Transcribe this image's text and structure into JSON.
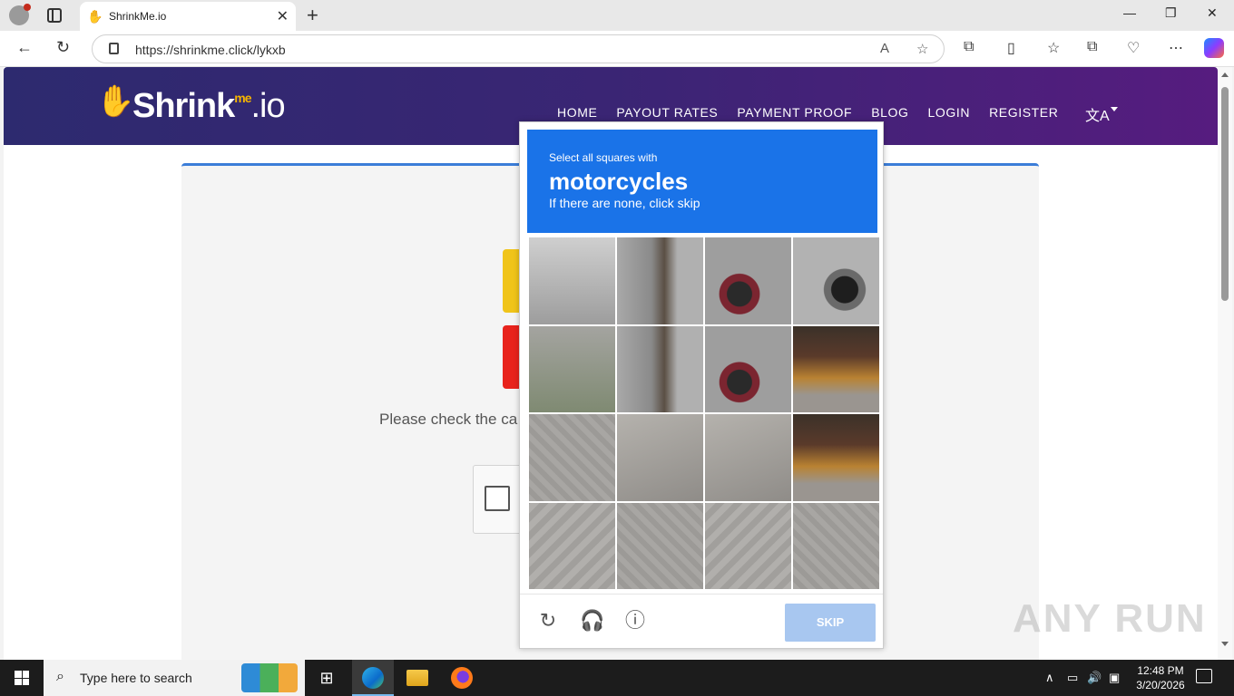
{
  "browser": {
    "tab_title": "ShrinkMe.io",
    "url": "https://shrinkme.click/lykxb",
    "new_tab_glyph": "+",
    "close_glyph": "✕"
  },
  "site": {
    "logo_main": "Shrink",
    "logo_me": "me",
    "logo_io": ".io",
    "nav": [
      "HOME",
      "PAYOUT RATES",
      "PAYMENT PROOF",
      "BLOG",
      "LOGIN",
      "REGISTER"
    ],
    "check_text": "Please check the ca"
  },
  "captcha": {
    "instruction": "Select all squares with",
    "target": "motorcycles",
    "hint": "If there are none, click skip",
    "skip_label": "SKIP",
    "grid_rows": 4,
    "grid_cols": 4
  },
  "watermark": "ANY RUN",
  "taskbar": {
    "search_placeholder": "Type here to search",
    "time": "12:48 PM",
    "date": "3/20/2026"
  },
  "colors": {
    "captcha_blue": "#1a73e8",
    "skip_disabled": "#a8c7f0",
    "header_gradient_start": "#2d2a6f",
    "header_gradient_end": "#561c7f"
  }
}
